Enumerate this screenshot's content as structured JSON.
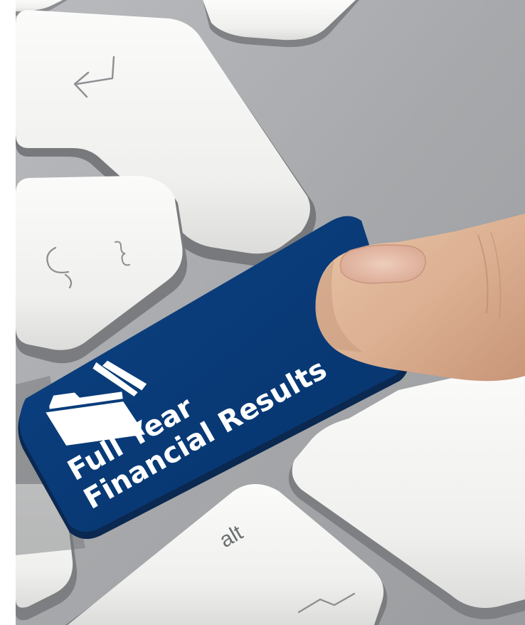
{
  "photo": {
    "key": {
      "line1": "Full Year",
      "line2": "Financial Results",
      "icon": "folder-icon",
      "color": "#0a3b78"
    },
    "alt_key": {
      "label": "alt"
    },
    "keyboard_color": "#a8aaad",
    "key_color": "#f1f1ef"
  }
}
